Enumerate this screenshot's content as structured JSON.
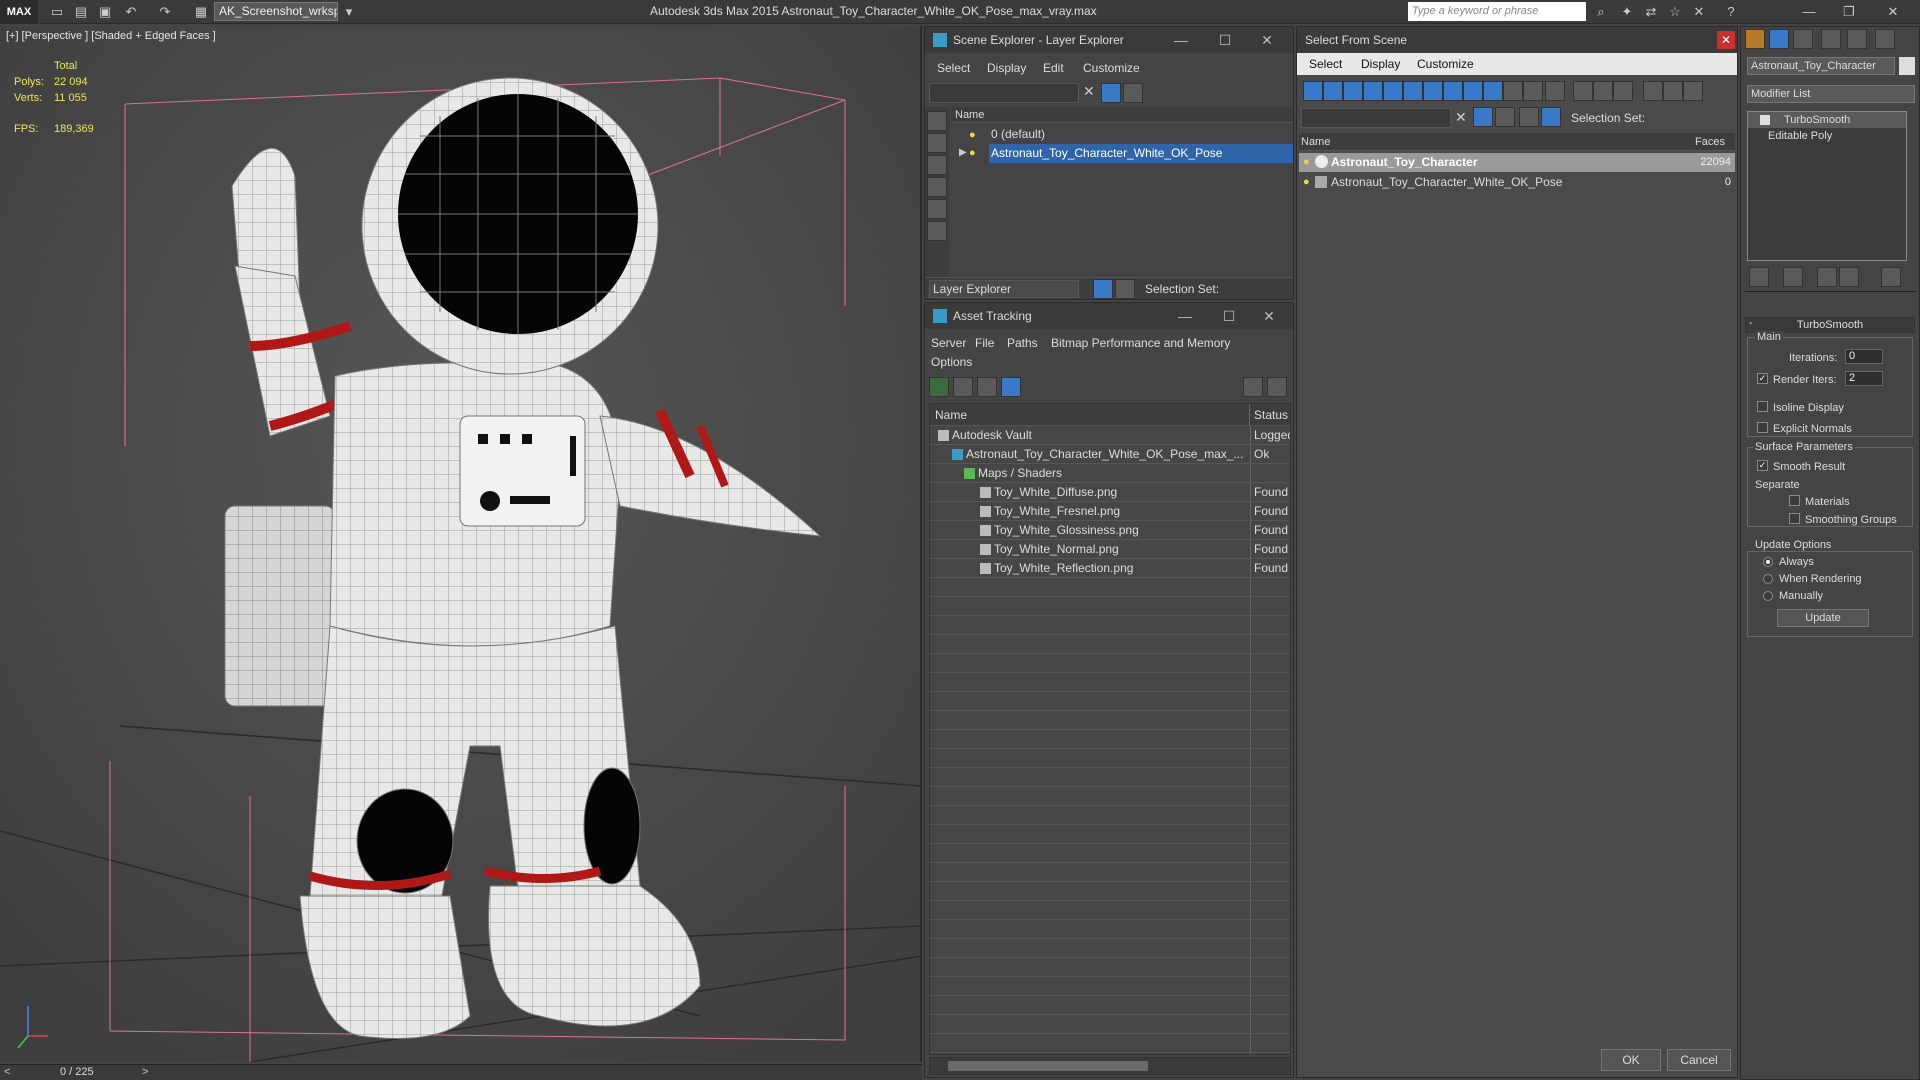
{
  "titlebar": {
    "app_logo": "MAX",
    "workspace": "AK_Screenshot_wrksp",
    "window_title": "Autodesk 3ds Max 2015     Astronaut_Toy_Character_White_OK_Pose_max_vray.max",
    "search_placeholder": "Type a keyword or phrase"
  },
  "viewport": {
    "label": "[+] [Perspective ] [Shaded + Edged Faces ]",
    "stats": {
      "total_label": "Total",
      "polys_label": "Polys:",
      "polys_value": "22 094",
      "verts_label": "Verts:",
      "verts_value": "11 055",
      "fps_label": "FPS:",
      "fps_value": "189,369"
    },
    "timeslider": "0 / 225"
  },
  "scene_explorer": {
    "title": "Scene Explorer - Layer Explorer",
    "menu": [
      "Select",
      "Display",
      "Edit",
      "Customize"
    ],
    "column": "Name",
    "rows": [
      "0 (default)",
      "Astronaut_Toy_Character_White_OK_Pose"
    ],
    "footer_explorer": "Layer Explorer",
    "footer_selection": "Selection Set:"
  },
  "asset_tracking": {
    "title": "Asset Tracking",
    "menu": [
      "Server",
      "File",
      "Paths",
      "Bitmap Performance and Memory"
    ],
    "menu2": "Options",
    "col_name": "Name",
    "col_status": "Status",
    "rows": [
      {
        "name": "Autodesk Vault",
        "status": "Logged"
      },
      {
        "name": "Astronaut_Toy_Character_White_OK_Pose_max_...",
        "status": "Ok"
      },
      {
        "name": "Maps / Shaders",
        "status": ""
      },
      {
        "name": "Toy_White_Diffuse.png",
        "status": "Found"
      },
      {
        "name": "Toy_White_Fresnel.png",
        "status": "Found"
      },
      {
        "name": "Toy_White_Glossiness.png",
        "status": "Found"
      },
      {
        "name": "Toy_White_Normal.png",
        "status": "Found"
      },
      {
        "name": "Toy_White_Reflection.png",
        "status": "Found"
      }
    ]
  },
  "select_from_scene": {
    "title": "Select From Scene",
    "menu": [
      "Select",
      "Display",
      "Customize"
    ],
    "selection_set": "Selection Set:",
    "col_name": "Name",
    "col_faces": "Faces",
    "rows": [
      {
        "name": "Astronaut_Toy_Character",
        "faces": "22094"
      },
      {
        "name": "Astronaut_Toy_Character_White_OK_Pose",
        "faces": "0"
      }
    ],
    "ok": "OK",
    "cancel": "Cancel"
  },
  "command_panel": {
    "object_name": "Astronaut_Toy_Character",
    "modifier_list": "Modifier List",
    "stack": [
      "TurboSmooth",
      "Editable Poly"
    ],
    "rollout_title": "TurboSmooth",
    "main_label": "Main",
    "iterations_label": "Iterations:",
    "iterations_value": "0",
    "render_iters_label": "Render Iters:",
    "render_iters_value": "2",
    "isoline": "Isoline Display",
    "explicit_normals": "Explicit Normals",
    "surface_params": "Surface Parameters",
    "smooth_result": "Smooth Result",
    "separate": "Separate",
    "materials": "Materials",
    "smoothing_groups": "Smoothing Groups",
    "update_options": "Update Options",
    "always": "Always",
    "when_rendering": "When Rendering",
    "manually": "Manually",
    "update_btn": "Update"
  },
  "colors": {
    "accent": "#2f64a8",
    "stats": "#e8e85a",
    "bbox": "#e06080"
  }
}
